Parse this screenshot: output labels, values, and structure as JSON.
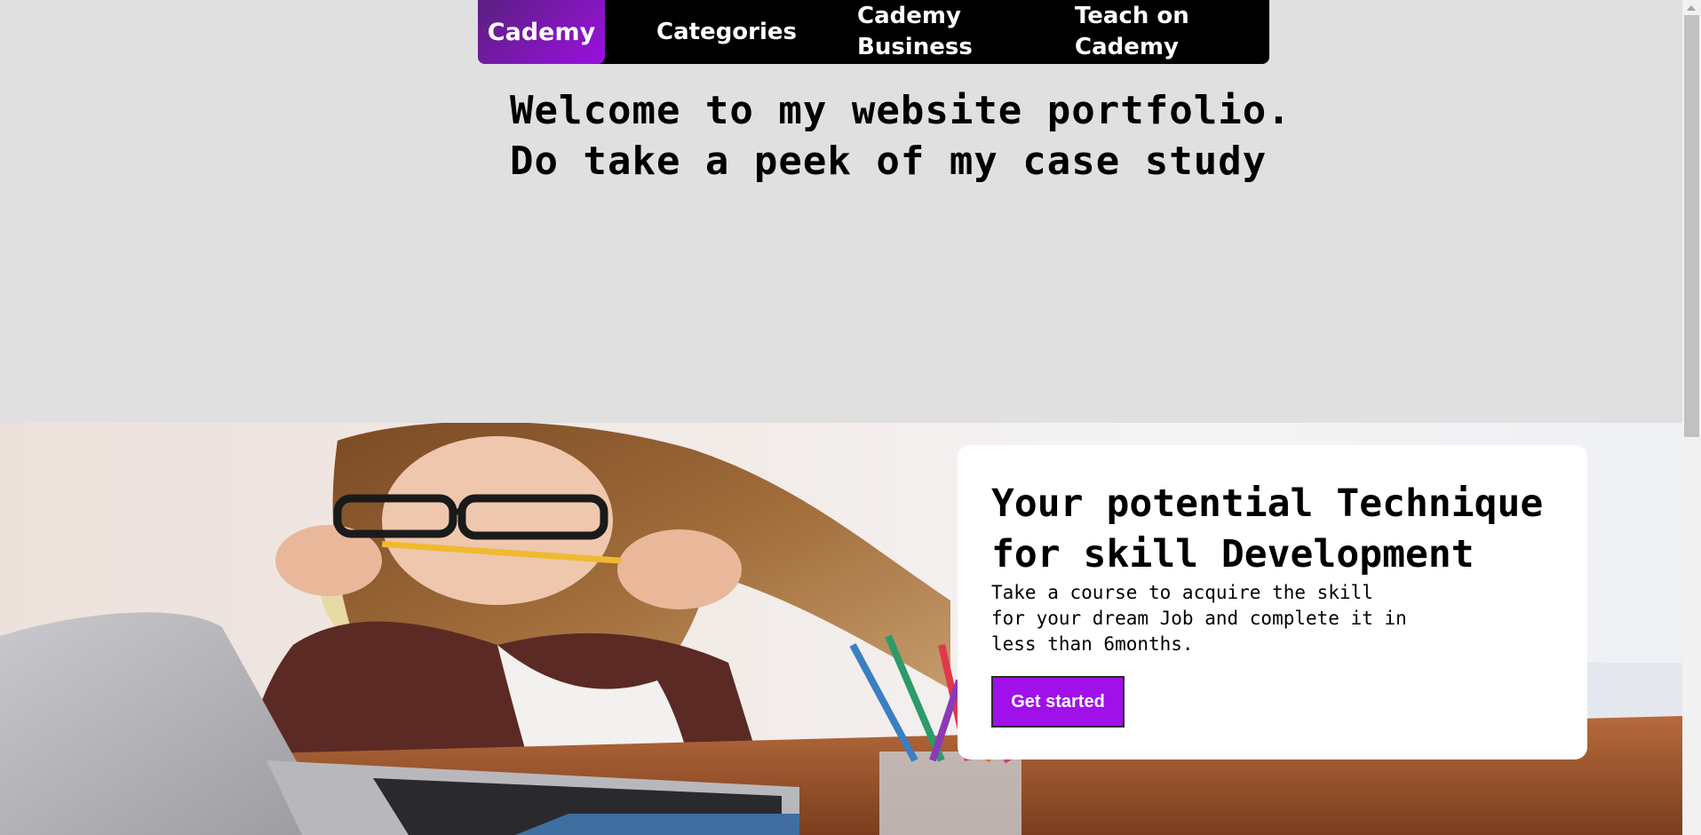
{
  "nav": {
    "brand": "Cademy",
    "items": [
      "Categories",
      "Cademy Business",
      "Teach on Cademy"
    ]
  },
  "intro": {
    "welcome": "Welcome to my website portfolio.\nDo take a peek of my case study"
  },
  "hero": {
    "photo": "student-laptop-photo",
    "card": {
      "title": "Your potential Technique for skill Development",
      "description": "Take a course to acquire the skill for your dream Job and complete it in less than 6months.",
      "button": "Get started"
    }
  },
  "colors": {
    "accent": "#a010e8",
    "nav_background": "#000000",
    "page_background": "#e0e0e0"
  }
}
